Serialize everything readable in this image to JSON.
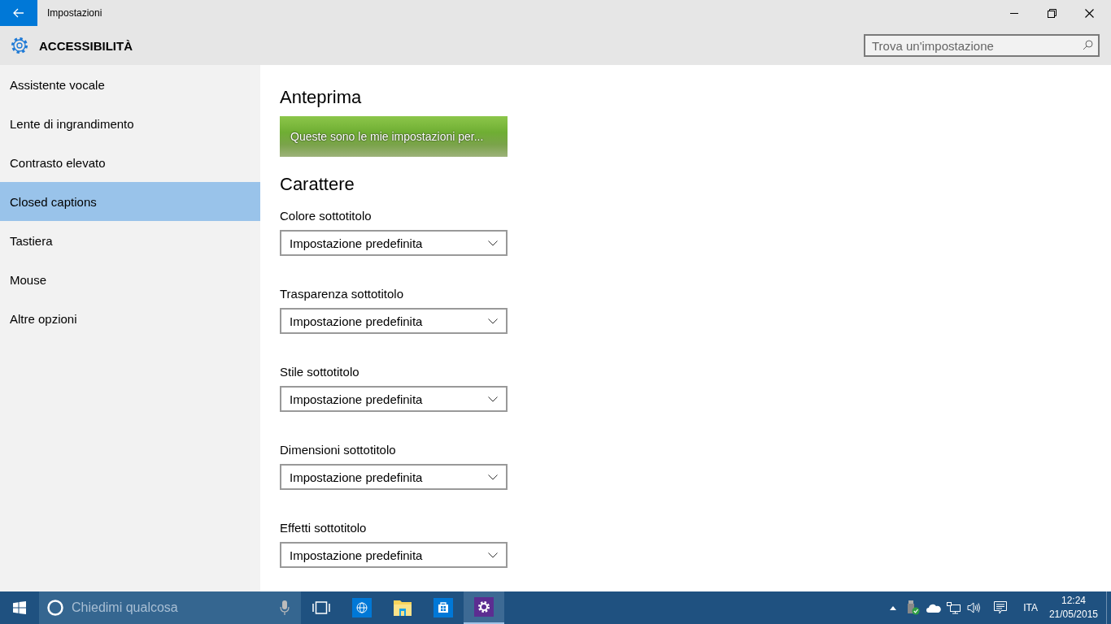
{
  "window": {
    "title": "Impostazioni"
  },
  "header": {
    "title": "ACCESSIBILITÀ",
    "search": {
      "placeholder": "Trova un'impostazione"
    }
  },
  "sidebar": {
    "items": [
      {
        "label": "Assistente vocale",
        "selected": false
      },
      {
        "label": "Lente di ingrandimento",
        "selected": false
      },
      {
        "label": "Contrasto elevato",
        "selected": false
      },
      {
        "label": "Closed captions",
        "selected": true
      },
      {
        "label": "Tastiera",
        "selected": false
      },
      {
        "label": "Mouse",
        "selected": false
      },
      {
        "label": "Altre opzioni",
        "selected": false
      }
    ]
  },
  "content": {
    "preview": {
      "heading": "Anteprima",
      "caption": "Queste sono le mie impostazioni per..."
    },
    "font_heading": "Carattere",
    "settings": [
      {
        "label": "Colore sottotitolo",
        "value": "Impostazione predefinita"
      },
      {
        "label": "Trasparenza sottotitolo",
        "value": "Impostazione predefinita"
      },
      {
        "label": "Stile sottotitolo",
        "value": "Impostazione predefinita"
      },
      {
        "label": "Dimensioni sottotitolo",
        "value": "Impostazione predefinita"
      },
      {
        "label": "Effetti sottotitolo",
        "value": "Impostazione predefinita"
      }
    ]
  },
  "taskbar": {
    "search": {
      "placeholder": "Chiedimi qualcosa"
    },
    "apps": [
      {
        "kind": "taskview",
        "selected": false
      },
      {
        "kind": "browser",
        "selected": false
      },
      {
        "kind": "folder",
        "selected": false
      },
      {
        "kind": "store",
        "selected": false
      },
      {
        "kind": "settings",
        "selected": true
      }
    ],
    "tray": {
      "language": "ITA",
      "time": "12:24",
      "date": "21/05/2015"
    }
  }
}
